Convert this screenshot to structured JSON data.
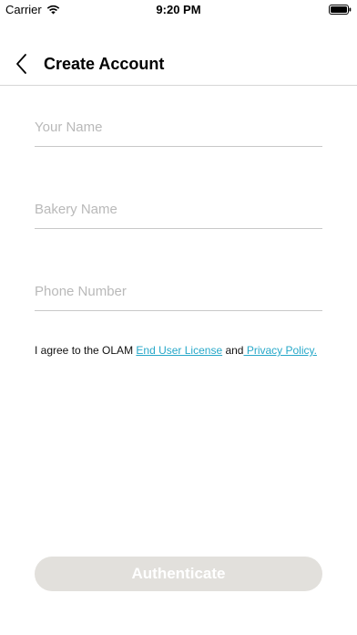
{
  "status_bar": {
    "carrier": "Carrier",
    "time": "9:20 PM"
  },
  "header": {
    "title": "Create Account"
  },
  "form": {
    "name_placeholder": "Your Name",
    "bakery_placeholder": "Bakery Name",
    "phone_placeholder": "Phone Number"
  },
  "agreement": {
    "prefix": "I agree to the OLAM ",
    "eula_link": "End User License",
    "connector": " and",
    "privacy_link": " Privacy Policy."
  },
  "actions": {
    "authenticate_label": "Authenticate"
  },
  "colors": {
    "link": "#27a8c9",
    "button_disabled_bg": "#e2e0dc",
    "divider": "#c8c8c8"
  }
}
